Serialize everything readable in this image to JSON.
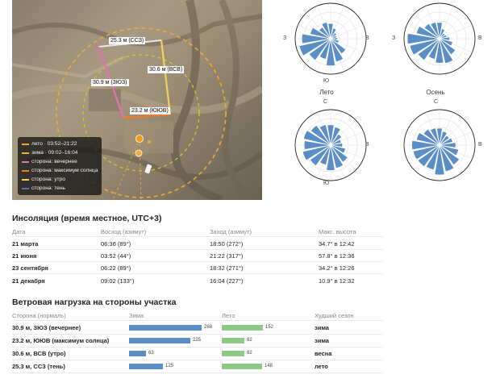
{
  "map": {
    "dimensions": [
      {
        "label": "25.3 м (ССЗ)"
      },
      {
        "label": "30.6 м (ВСВ)"
      },
      {
        "label": "30.9 м (ЗЮЗ)"
      },
      {
        "label": "23.2 м (ЮЮВ)"
      }
    ],
    "legend": [
      {
        "text": "лето · 03:52–21:22",
        "color": "#f2a93b",
        "style": "dashed"
      },
      {
        "text": "зима · 09:02–16:04",
        "color": "#d9c12a",
        "style": "dashed"
      },
      {
        "text": "сторона: вечернее",
        "color": "#e86fb2",
        "style": "solid"
      },
      {
        "text": "сторона: максимум солнца",
        "color": "#f07a2a",
        "style": "solid"
      },
      {
        "text": "сторона: утро",
        "color": "#f2d25a",
        "style": "solid"
      },
      {
        "text": "сторона: тень",
        "color": "#4d74c7",
        "style": "solid"
      }
    ]
  },
  "roses": {
    "directions": {
      "north": "С",
      "south": "Ю",
      "west": "З",
      "east": "В"
    },
    "color": "#5b8ec7",
    "items": [
      {
        "label": "",
        "shows_north": false,
        "shows_south": true,
        "shows_west": true,
        "shows_east": true,
        "petals": [
          0.45,
          0.32,
          0.22,
          0.18,
          0.2,
          0.25,
          0.55,
          0.7,
          0.8,
          0.62,
          0.78,
          0.95,
          0.85,
          0.62,
          0.42,
          0.5
        ]
      },
      {
        "label": "",
        "shows_north": false,
        "shows_south": false,
        "shows_west": true,
        "shows_east": true,
        "petals": [
          0.48,
          0.3,
          0.2,
          0.22,
          0.3,
          0.4,
          0.58,
          0.75,
          0.72,
          0.62,
          0.78,
          0.9,
          0.95,
          0.7,
          0.55,
          0.5
        ]
      },
      {
        "label": "Лето",
        "shows_north": true,
        "shows_south": true,
        "shows_west": false,
        "shows_east": true,
        "petals": [
          0.6,
          0.55,
          0.4,
          0.32,
          0.35,
          0.45,
          0.62,
          0.7,
          0.75,
          0.6,
          0.75,
          0.85,
          0.78,
          0.82,
          0.72,
          0.62
        ]
      },
      {
        "label": "Осень",
        "shows_north": true,
        "shows_south": false,
        "shows_west": false,
        "shows_east": true,
        "petals": [
          0.5,
          0.42,
          0.35,
          0.4,
          0.48,
          0.58,
          0.72,
          0.8,
          0.88,
          0.75,
          0.78,
          0.8,
          0.82,
          0.7,
          0.58,
          0.52
        ]
      }
    ]
  },
  "insolation": {
    "title": "Инсоляция (время местное, UTC+3)",
    "headers": [
      "Дата",
      "Восход (азимут)",
      "Заход (азимут)",
      "Макс. высота"
    ],
    "rows": [
      [
        "21 марта",
        "06:36 (89°)",
        "18:50 (272°)",
        "34.7° в 12:42"
      ],
      [
        "21 июня",
        "03:52 (44°)",
        "21:22 (317°)",
        "57.8° в 12:36"
      ],
      [
        "23 сентября",
        "06:22 (89°)",
        "18:32 (271°)",
        "34.2° в 12:26"
      ],
      [
        "21 декабря",
        "09:02 (133°)",
        "16:04 (227°)",
        "10.9° в 12:32"
      ]
    ]
  },
  "wind": {
    "title": "Ветровая нагрузка на стороны участка",
    "headers": [
      "Сторона (нормаль)",
      "Зима",
      "Лето",
      "Худший сезон"
    ],
    "bar_scale_max": 268,
    "colors": {
      "winter": "#5b8ec7",
      "summer": "#8fc98a"
    },
    "rows": [
      {
        "side": "30.9 м, ЗЮЗ (вечернее)",
        "winter": 268,
        "summer": 152,
        "worst": "зима"
      },
      {
        "side": "23.2 м, ЮЮВ (максимум солнца)",
        "winter": 225,
        "summer": 82,
        "worst": "зима"
      },
      {
        "side": "30.6 м, ВСВ (утро)",
        "winter": 63,
        "summer": 82,
        "worst": "весна"
      },
      {
        "side": "25.3 м, ССЗ (тень)",
        "winter": 125,
        "summer": 148,
        "worst": "лето"
      }
    ]
  }
}
